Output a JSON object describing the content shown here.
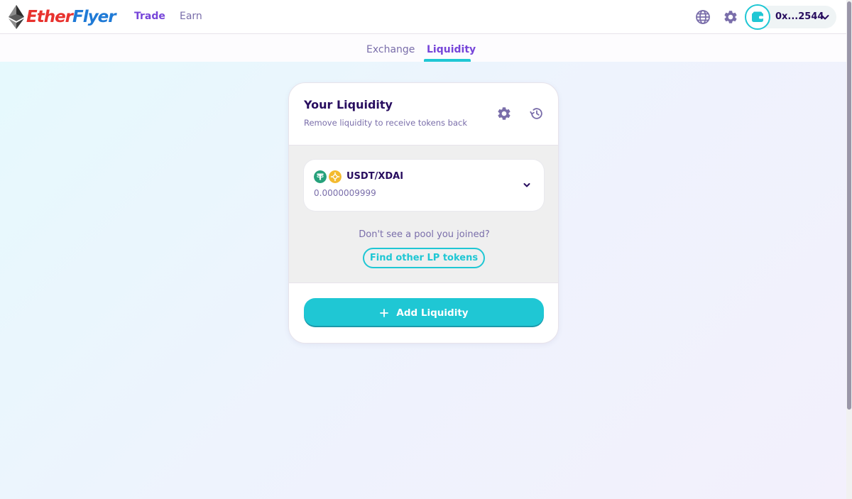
{
  "brand": {
    "name_part1": "Ether",
    "name_part2": "Flyer",
    "colors": {
      "part1": "#e8322e",
      "part2": "#1f7ad6"
    },
    "logo_icon": "ethereum-diamond-icon"
  },
  "nav": {
    "items": [
      {
        "label": "Trade",
        "active": true
      },
      {
        "label": "Earn",
        "active": false
      }
    ]
  },
  "header_actions": {
    "language_icon": "globe-icon",
    "settings_icon": "gear-icon",
    "wallet": {
      "icon": "wallet-icon",
      "address": "0x...2544"
    }
  },
  "subnav": {
    "tabs": [
      {
        "label": "Exchange",
        "active": false
      },
      {
        "label": "Liquidity",
        "active": true
      }
    ]
  },
  "card": {
    "title": "Your Liquidity",
    "subtitle": "Remove liquidity to receive tokens back",
    "settings_icon": "gear-icon",
    "history_icon": "history-icon",
    "pools": [
      {
        "token_icons": [
          "usdt-icon",
          "bnb-icon"
        ],
        "name": "USDT/XDAI",
        "balance": "0.0000009999"
      }
    ],
    "no_pool_text": "Don't see a pool you joined?",
    "find_lp_label": "Find other LP tokens",
    "add_liquidity_label": "Add Liquidity"
  },
  "colors": {
    "primary": "#1fc7d4",
    "secondary": "#7645d9",
    "text": "#280d5f",
    "text_subtle": "#7a6eaa",
    "usdt": "#26a17b",
    "bnb": "#f3ba2f"
  }
}
